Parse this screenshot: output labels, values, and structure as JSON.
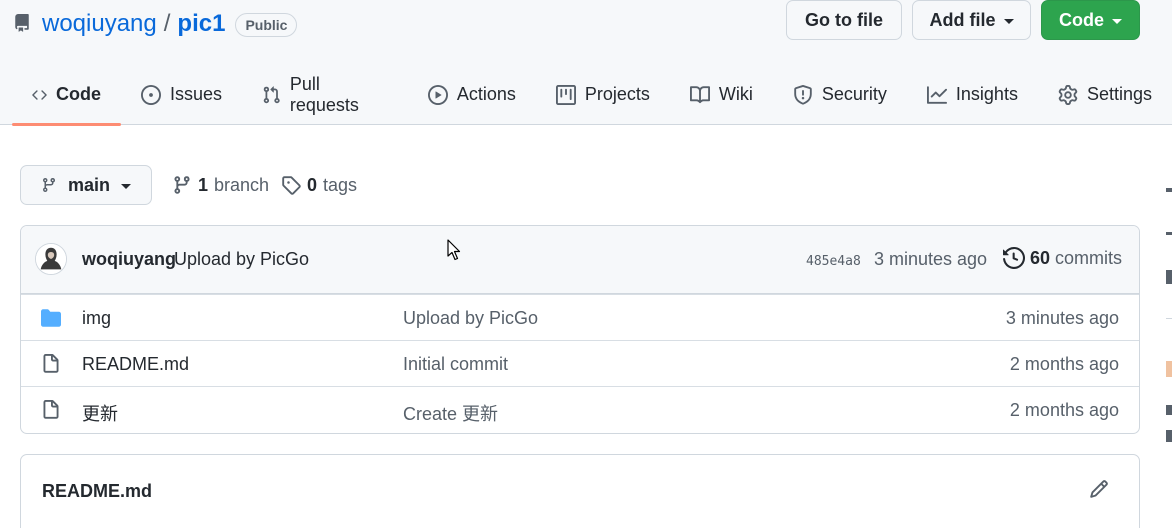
{
  "repo": {
    "owner": "woqiuyang",
    "separator": "/",
    "name": "pic1",
    "visibility": "Public"
  },
  "tabs": [
    {
      "label": "Code",
      "icon": "code-icon",
      "selected": true
    },
    {
      "label": "Issues",
      "icon": "issue-opened-icon"
    },
    {
      "label": "Pull requests",
      "icon": "git-pull-request-icon"
    },
    {
      "label": "Actions",
      "icon": "play-icon"
    },
    {
      "label": "Projects",
      "icon": "table-icon"
    },
    {
      "label": "Wiki",
      "icon": "book-icon"
    },
    {
      "label": "Security",
      "icon": "shield-icon"
    },
    {
      "label": "Insights",
      "icon": "graph-icon"
    },
    {
      "label": "Settings",
      "icon": "gear-icon"
    }
  ],
  "toolbar": {
    "branch": "main",
    "branch_count": "1",
    "branch_label": "branch",
    "tag_count": "0",
    "tag_label": "tags",
    "goto_file": "Go to file",
    "add_file": "Add file",
    "code": "Code"
  },
  "latest_commit": {
    "author": "woqiuyang",
    "message": "Upload by PicGo",
    "sha": "485e4a8",
    "time": "3 minutes ago",
    "commit_count": "60",
    "commit_label": "commits"
  },
  "files": [
    {
      "type": "directory",
      "icon": "folder-icon",
      "name": "img",
      "message": "Upload by PicGo",
      "time": "3 minutes ago"
    },
    {
      "type": "file",
      "icon": "file-icon",
      "name": "README.md",
      "message": "Initial commit",
      "time": "2 months ago"
    },
    {
      "type": "file",
      "icon": "file-icon",
      "name": "更新",
      "message": "Create 更新",
      "time": "2 months ago"
    }
  ],
  "readme": {
    "title": "README.md"
  },
  "colors": {
    "accent_link": "#0969da",
    "selected_tab_underline": "#fd8c73",
    "primary_button": "#2da44e",
    "folder": "#54aeff"
  }
}
